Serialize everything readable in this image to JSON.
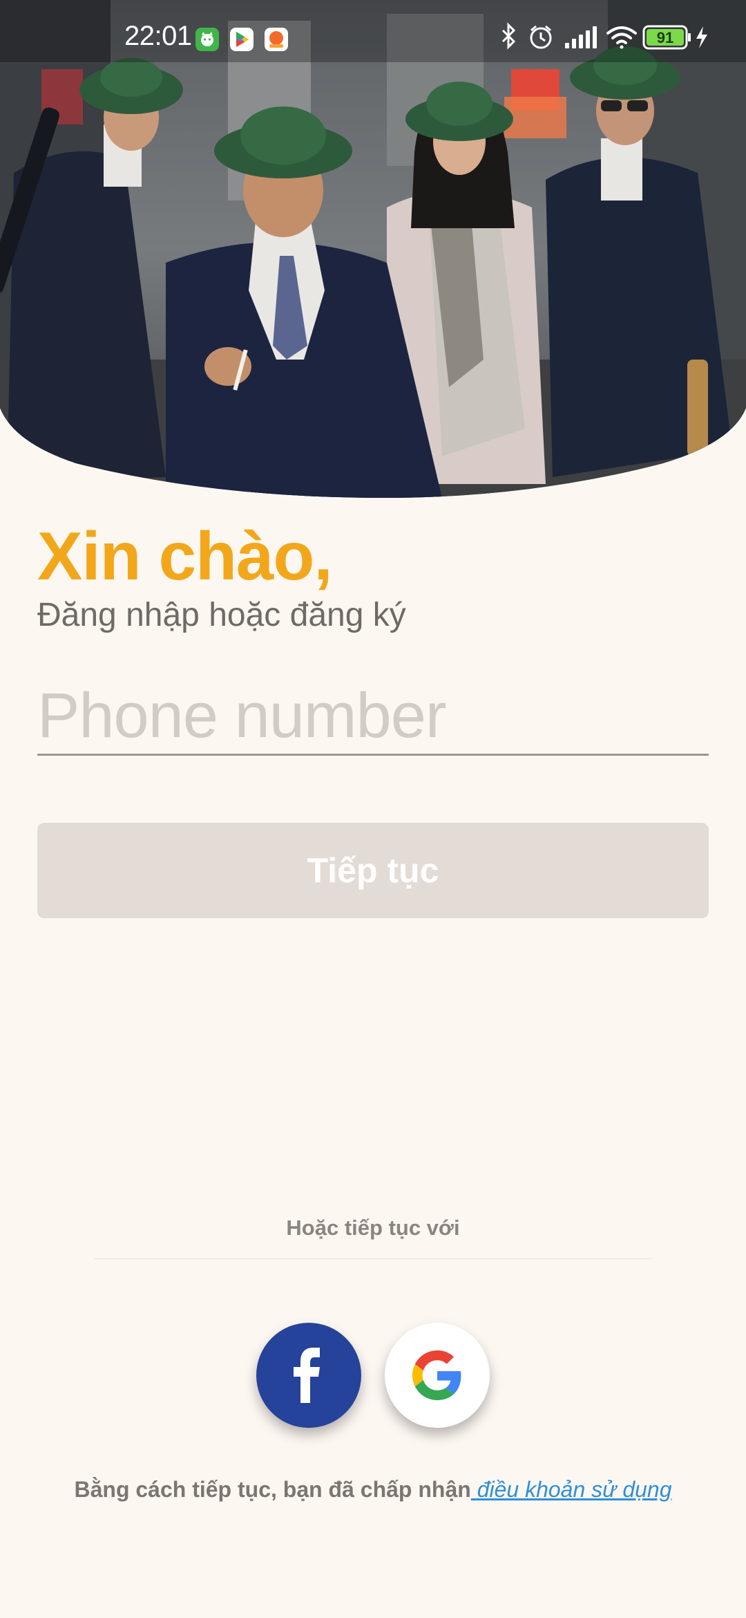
{
  "status_bar": {
    "time": "22:01",
    "battery_level": "91",
    "app_icons": [
      "cat-app-icon",
      "play-store-icon",
      "orange-app-icon"
    ],
    "system_icons": [
      "bluetooth-icon",
      "alarm-icon",
      "signal-icon",
      "wifi-icon",
      "battery-icon",
      "charging-icon"
    ]
  },
  "hero": {
    "image": "hero-photo"
  },
  "greeting": {
    "title": "Xin chào,",
    "subtitle": "Đăng nhập hoặc đăng ký"
  },
  "phone": {
    "placeholder": "Phone number",
    "value": ""
  },
  "continue_button": {
    "label": "Tiếp tục"
  },
  "alternatives": {
    "label": "Hoặc tiếp tục với",
    "providers": [
      {
        "name": "facebook",
        "icon": "facebook-icon"
      },
      {
        "name": "google",
        "icon": "google-icon"
      }
    ]
  },
  "terms": {
    "text": "Bằng cách tiếp tục, bạn đã chấp nhận",
    "link": " điều khoản sử dụng"
  },
  "colors": {
    "background": "#fdf7f2",
    "accent": "#f2a71b",
    "button_disabled": "#e3dbd6",
    "facebook": "#25439a",
    "link": "#2f8fd8"
  }
}
